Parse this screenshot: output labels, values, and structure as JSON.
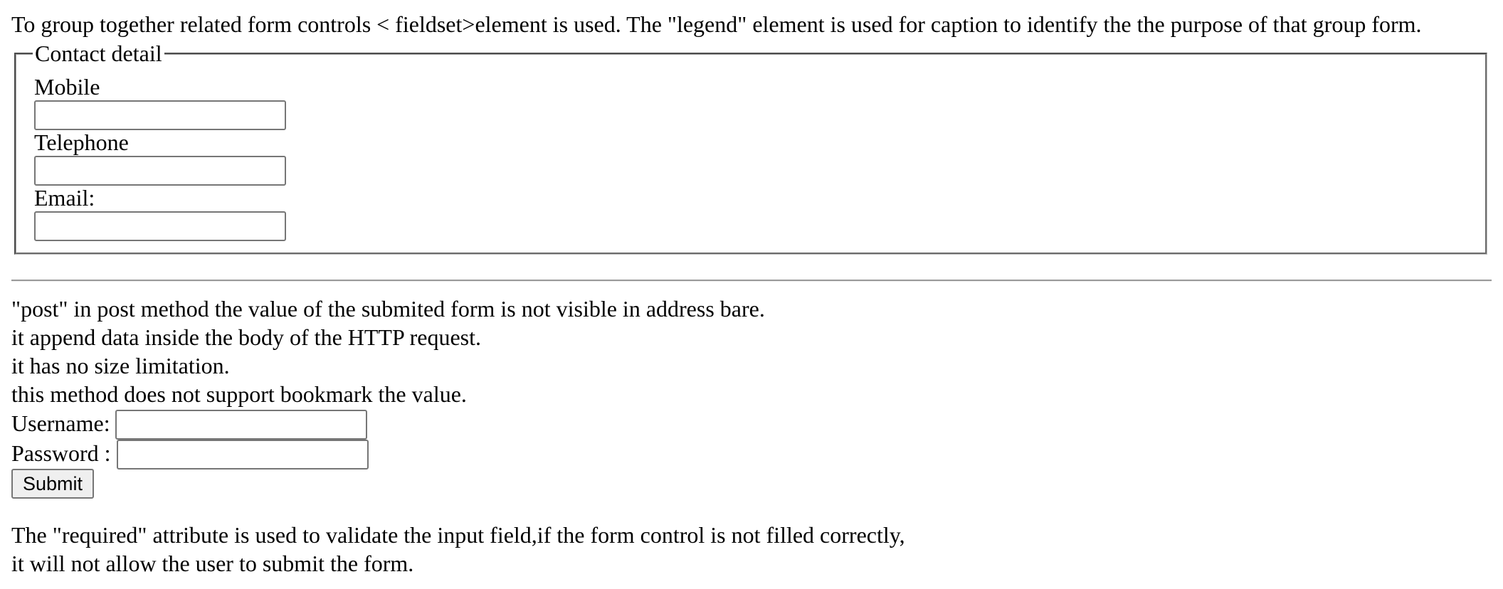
{
  "intro": {
    "text": "To group together related form controls < fieldset>element is used. The \"legend\" element is used for caption to identify the the purpose of that group form."
  },
  "fieldset": {
    "legend": "Contact detail",
    "fields": [
      {
        "label": "Mobile",
        "value": "",
        "placeholder": ""
      },
      {
        "label": "Telephone",
        "value": "",
        "placeholder": ""
      },
      {
        "label": "Email:",
        "value": "",
        "placeholder": ""
      }
    ]
  },
  "post_notes": [
    "\"post\" in post method the value of the submited form is not visible in address bare.",
    "it append data inside the body of the HTTP request.",
    "it has no size limitation.",
    "this method does not support bookmark the value."
  ],
  "login_form": {
    "username_label": "Username:",
    "username_value": "",
    "password_label": "Password :",
    "password_value": "",
    "submit_label": "Submit"
  },
  "required_notes": [
    "The \"required\" attribute is used to validate the input field,if the form control is not filled correctly,",
    "it will not allow the user to submit the form."
  ]
}
